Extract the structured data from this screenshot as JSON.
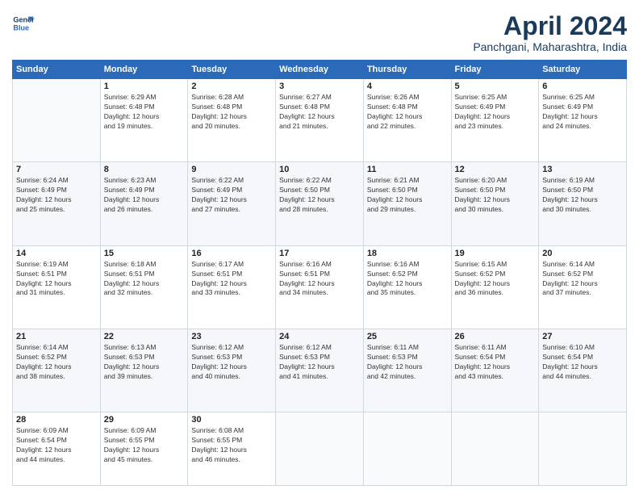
{
  "header": {
    "logo_line1": "General",
    "logo_line2": "Blue",
    "month_year": "April 2024",
    "location": "Panchgani, Maharashtra, India"
  },
  "days_of_week": [
    "Sunday",
    "Monday",
    "Tuesday",
    "Wednesday",
    "Thursday",
    "Friday",
    "Saturday"
  ],
  "weeks": [
    [
      {
        "day": "",
        "info": ""
      },
      {
        "day": "1",
        "info": "Sunrise: 6:29 AM\nSunset: 6:48 PM\nDaylight: 12 hours\nand 19 minutes."
      },
      {
        "day": "2",
        "info": "Sunrise: 6:28 AM\nSunset: 6:48 PM\nDaylight: 12 hours\nand 20 minutes."
      },
      {
        "day": "3",
        "info": "Sunrise: 6:27 AM\nSunset: 6:48 PM\nDaylight: 12 hours\nand 21 minutes."
      },
      {
        "day": "4",
        "info": "Sunrise: 6:26 AM\nSunset: 6:48 PM\nDaylight: 12 hours\nand 22 minutes."
      },
      {
        "day": "5",
        "info": "Sunrise: 6:25 AM\nSunset: 6:49 PM\nDaylight: 12 hours\nand 23 minutes."
      },
      {
        "day": "6",
        "info": "Sunrise: 6:25 AM\nSunset: 6:49 PM\nDaylight: 12 hours\nand 24 minutes."
      }
    ],
    [
      {
        "day": "7",
        "info": "Sunrise: 6:24 AM\nSunset: 6:49 PM\nDaylight: 12 hours\nand 25 minutes."
      },
      {
        "day": "8",
        "info": "Sunrise: 6:23 AM\nSunset: 6:49 PM\nDaylight: 12 hours\nand 26 minutes."
      },
      {
        "day": "9",
        "info": "Sunrise: 6:22 AM\nSunset: 6:49 PM\nDaylight: 12 hours\nand 27 minutes."
      },
      {
        "day": "10",
        "info": "Sunrise: 6:22 AM\nSunset: 6:50 PM\nDaylight: 12 hours\nand 28 minutes."
      },
      {
        "day": "11",
        "info": "Sunrise: 6:21 AM\nSunset: 6:50 PM\nDaylight: 12 hours\nand 29 minutes."
      },
      {
        "day": "12",
        "info": "Sunrise: 6:20 AM\nSunset: 6:50 PM\nDaylight: 12 hours\nand 30 minutes."
      },
      {
        "day": "13",
        "info": "Sunrise: 6:19 AM\nSunset: 6:50 PM\nDaylight: 12 hours\nand 30 minutes."
      }
    ],
    [
      {
        "day": "14",
        "info": "Sunrise: 6:19 AM\nSunset: 6:51 PM\nDaylight: 12 hours\nand 31 minutes."
      },
      {
        "day": "15",
        "info": "Sunrise: 6:18 AM\nSunset: 6:51 PM\nDaylight: 12 hours\nand 32 minutes."
      },
      {
        "day": "16",
        "info": "Sunrise: 6:17 AM\nSunset: 6:51 PM\nDaylight: 12 hours\nand 33 minutes."
      },
      {
        "day": "17",
        "info": "Sunrise: 6:16 AM\nSunset: 6:51 PM\nDaylight: 12 hours\nand 34 minutes."
      },
      {
        "day": "18",
        "info": "Sunrise: 6:16 AM\nSunset: 6:52 PM\nDaylight: 12 hours\nand 35 minutes."
      },
      {
        "day": "19",
        "info": "Sunrise: 6:15 AM\nSunset: 6:52 PM\nDaylight: 12 hours\nand 36 minutes."
      },
      {
        "day": "20",
        "info": "Sunrise: 6:14 AM\nSunset: 6:52 PM\nDaylight: 12 hours\nand 37 minutes."
      }
    ],
    [
      {
        "day": "21",
        "info": "Sunrise: 6:14 AM\nSunset: 6:52 PM\nDaylight: 12 hours\nand 38 minutes."
      },
      {
        "day": "22",
        "info": "Sunrise: 6:13 AM\nSunset: 6:53 PM\nDaylight: 12 hours\nand 39 minutes."
      },
      {
        "day": "23",
        "info": "Sunrise: 6:12 AM\nSunset: 6:53 PM\nDaylight: 12 hours\nand 40 minutes."
      },
      {
        "day": "24",
        "info": "Sunrise: 6:12 AM\nSunset: 6:53 PM\nDaylight: 12 hours\nand 41 minutes."
      },
      {
        "day": "25",
        "info": "Sunrise: 6:11 AM\nSunset: 6:53 PM\nDaylight: 12 hours\nand 42 minutes."
      },
      {
        "day": "26",
        "info": "Sunrise: 6:11 AM\nSunset: 6:54 PM\nDaylight: 12 hours\nand 43 minutes."
      },
      {
        "day": "27",
        "info": "Sunrise: 6:10 AM\nSunset: 6:54 PM\nDaylight: 12 hours\nand 44 minutes."
      }
    ],
    [
      {
        "day": "28",
        "info": "Sunrise: 6:09 AM\nSunset: 6:54 PM\nDaylight: 12 hours\nand 44 minutes."
      },
      {
        "day": "29",
        "info": "Sunrise: 6:09 AM\nSunset: 6:55 PM\nDaylight: 12 hours\nand 45 minutes."
      },
      {
        "day": "30",
        "info": "Sunrise: 6:08 AM\nSunset: 6:55 PM\nDaylight: 12 hours\nand 46 minutes."
      },
      {
        "day": "",
        "info": ""
      },
      {
        "day": "",
        "info": ""
      },
      {
        "day": "",
        "info": ""
      },
      {
        "day": "",
        "info": ""
      }
    ]
  ]
}
